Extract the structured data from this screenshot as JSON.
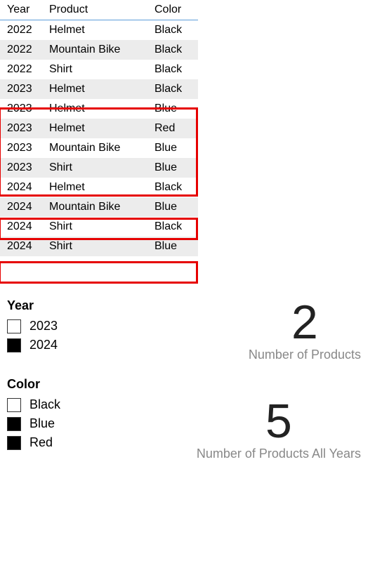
{
  "table": {
    "headers": {
      "year": "Year",
      "product": "Product",
      "color": "Color"
    },
    "rows": [
      {
        "year": "2022",
        "product": "Helmet",
        "color": "Black",
        "highlighted": false
      },
      {
        "year": "2022",
        "product": "Mountain Bike",
        "color": "Black",
        "highlighted": false
      },
      {
        "year": "2022",
        "product": "Shirt",
        "color": "Black",
        "highlighted": false
      },
      {
        "year": "2023",
        "product": "Helmet",
        "color": "Black",
        "highlighted": false
      },
      {
        "year": "2023",
        "product": "Helmet",
        "color": "Blue",
        "highlighted": true
      },
      {
        "year": "2023",
        "product": "Helmet",
        "color": "Red",
        "highlighted": true
      },
      {
        "year": "2023",
        "product": "Mountain Bike",
        "color": "Blue",
        "highlighted": true
      },
      {
        "year": "2023",
        "product": "Shirt",
        "color": "Blue",
        "highlighted": true
      },
      {
        "year": "2024",
        "product": "Helmet",
        "color": "Black",
        "highlighted": false
      },
      {
        "year": "2024",
        "product": "Mountain Bike",
        "color": "Blue",
        "highlighted": true
      },
      {
        "year": "2024",
        "product": "Shirt",
        "color": "Black",
        "highlighted": false
      },
      {
        "year": "2024",
        "product": "Shirt",
        "color": "Blue",
        "highlighted": true
      }
    ]
  },
  "slicers": {
    "year": {
      "title": "Year",
      "items": [
        {
          "label": "2023",
          "checked": false
        },
        {
          "label": "2024",
          "checked": true
        }
      ]
    },
    "color": {
      "title": "Color",
      "items": [
        {
          "label": "Black",
          "checked": false
        },
        {
          "label": "Blue",
          "checked": true
        },
        {
          "label": "Red",
          "checked": true
        }
      ]
    }
  },
  "cards": {
    "products": {
      "value": "2",
      "label": "Number of Products"
    },
    "productsAllYears": {
      "value": "5",
      "label": "Number of Products All Years"
    }
  }
}
